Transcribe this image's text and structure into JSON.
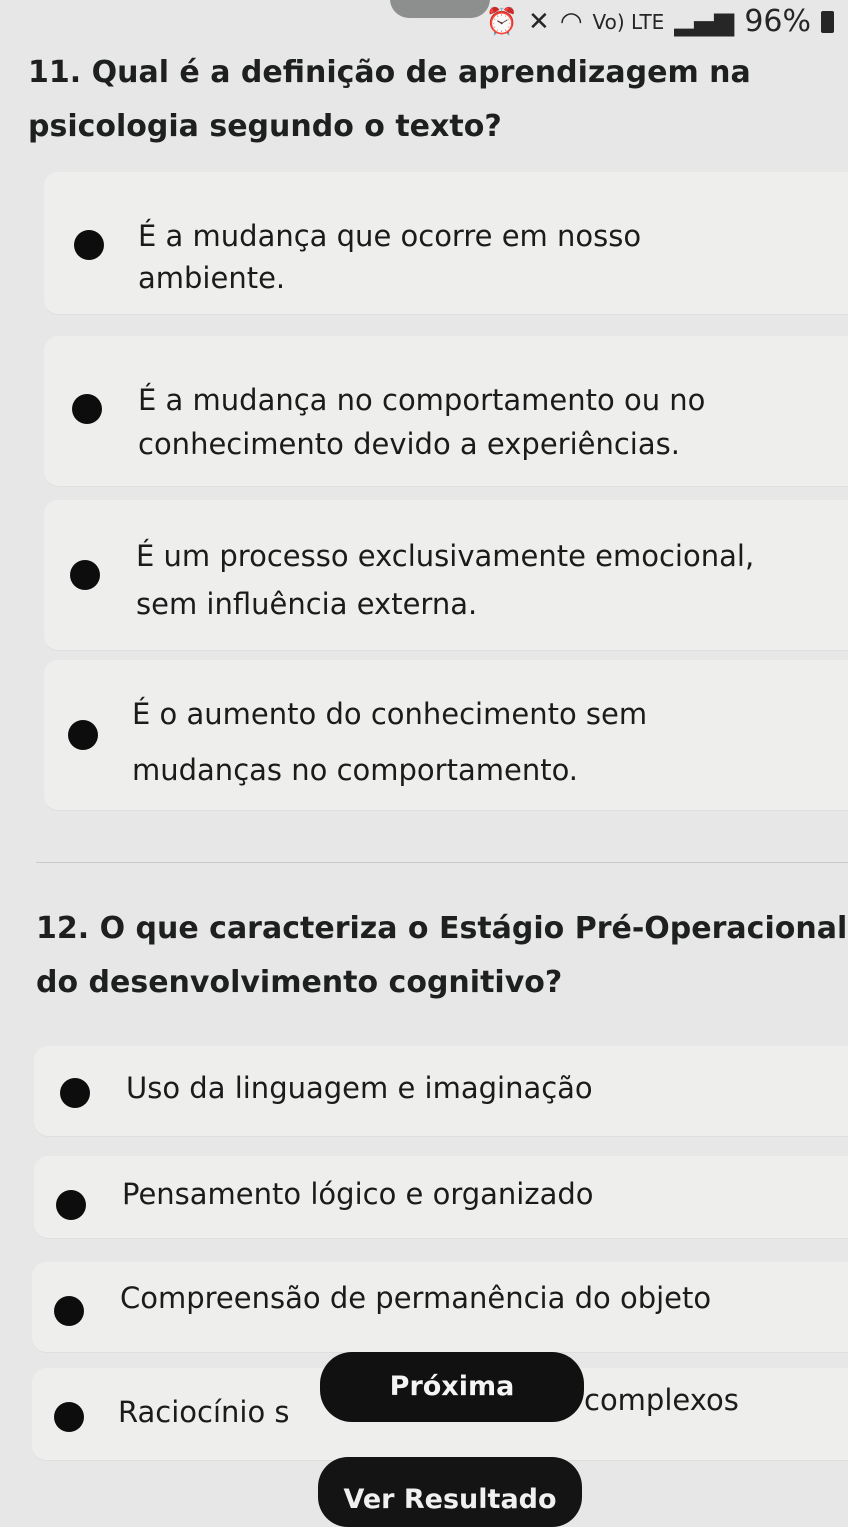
{
  "status_bar": {
    "alarm_icon": "alarm-icon",
    "mute_icon": "vibrate-mute-icon",
    "wifi_icon": "wifi-icon",
    "network_label": "Vo) LTE",
    "signal_icon": "signal-bars-icon",
    "battery": "96%",
    "battery_icon": "battery-icon"
  },
  "questions": [
    {
      "title": "11. Qual é a definição de aprendizagem na psicologia segundo o texto?",
      "title_line1": "11. Qual é a definição de aprendizagem na",
      "title_line2": "psicologia segundo o texto?",
      "options": [
        {
          "line1": "É a mudança que ocorre em nosso",
          "line2": "ambiente."
        },
        {
          "line1": "É a mudança no comportamento ou no",
          "line2": "conhecimento devido a experiências."
        },
        {
          "line1": "É um processo exclusivamente emocional,",
          "line2": "sem influência externa."
        },
        {
          "line1": "É o aumento do conhecimento sem",
          "line2": "mudanças no comportamento."
        }
      ]
    },
    {
      "title_line1": "12. O que caracteriza o Estágio Pré-Operacional",
      "title_line2": "do desenvolvimento cognitivo?",
      "options": [
        {
          "line1": "Uso da linguagem e imaginação"
        },
        {
          "line1": "Pensamento lógico e organizado"
        },
        {
          "line1": "Compreensão de permanência do objeto"
        },
        {
          "line1_left": "Raciocínio s",
          "line1_right": "complexos"
        }
      ]
    }
  ],
  "buttons": {
    "next": "Próxima",
    "results": "Ver Resultado"
  }
}
